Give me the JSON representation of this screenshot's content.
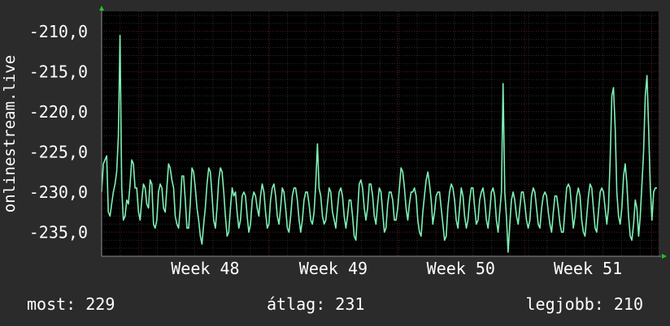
{
  "chart_data": {
    "type": "line",
    "ylabel": "onlinestream.live",
    "ylim": [
      -238.0,
      -207.5
    ],
    "yticks": [
      -235,
      -230,
      -225,
      -220,
      -215,
      -210
    ],
    "ytick_labels": [
      "-235,0",
      "-230,0",
      "-225,0",
      "-220,0",
      "-215,0",
      "-210,0"
    ],
    "xticks": [
      {
        "label": "Week 48",
        "pos": 0.186
      },
      {
        "label": "Week 49",
        "pos": 0.416
      },
      {
        "label": "Week 50",
        "pos": 0.645
      },
      {
        "label": "Week 51",
        "pos": 0.873
      }
    ],
    "grid": true,
    "colors": {
      "background": "#2b2b2b",
      "plot_bg": "#000000",
      "grid_major": "#5a1c1c",
      "grid_minor": "#2c2c2c",
      "line": "#7ef0b4",
      "axis": "#8c8c8c",
      "arrow": "#23c623"
    },
    "series": [
      {
        "values": [
          -230.0,
          -226.5,
          -226.0,
          -225.5,
          -232.5,
          -233.0,
          -231.5,
          -230.0,
          -229.0,
          -227.5,
          -223.0,
          -210.5,
          -229.5,
          -233.5,
          -233.0,
          -231.0,
          -231.5,
          -229.0,
          -226.0,
          -226.5,
          -229.5,
          -229.5,
          -232.5,
          -233.5,
          -231.0,
          -229.0,
          -229.5,
          -231.5,
          -232.0,
          -228.5,
          -229.0,
          -234.0,
          -234.5,
          -233.5,
          -230.0,
          -229.0,
          -229.5,
          -232.0,
          -232.5,
          -229.5,
          -226.5,
          -227.0,
          -228.5,
          -229.5,
          -233.0,
          -234.0,
          -234.5,
          -232.0,
          -228.0,
          -228.0,
          -231.0,
          -234.5,
          -234.5,
          -231.5,
          -227.0,
          -227.5,
          -229.5,
          -232.0,
          -233.5,
          -235.5,
          -236.5,
          -234.0,
          -232.0,
          -229.0,
          -227.0,
          -227.5,
          -230.5,
          -233.5,
          -234.5,
          -232.0,
          -228.5,
          -227.0,
          -227.5,
          -230.0,
          -233.0,
          -235.5,
          -235.0,
          -232.0,
          -229.5,
          -230.5,
          -230.0,
          -232.5,
          -234.5,
          -233.5,
          -230.5,
          -230.0,
          -230.5,
          -233.0,
          -235.0,
          -234.0,
          -231.0,
          -230.0,
          -230.5,
          -232.0,
          -233.0,
          -230.5,
          -229.0,
          -230.0,
          -232.5,
          -234.5,
          -234.0,
          -231.0,
          -229.5,
          -229.0,
          -230.5,
          -233.0,
          -234.0,
          -232.0,
          -229.5,
          -230.0,
          -232.0,
          -234.5,
          -235.0,
          -233.0,
          -230.5,
          -229.5,
          -229.5,
          -231.0,
          -233.5,
          -235.0,
          -233.5,
          -231.0,
          -230.0,
          -230.0,
          -231.5,
          -233.5,
          -234.0,
          -232.5,
          -229.0,
          -224.0,
          -229.5,
          -230.5,
          -233.0,
          -234.0,
          -233.5,
          -231.5,
          -229.5,
          -230.0,
          -232.5,
          -233.5,
          -234.5,
          -232.0,
          -230.0,
          -229.5,
          -230.5,
          -233.0,
          -234.5,
          -233.0,
          -231.0,
          -231.0,
          -233.0,
          -235.5,
          -236.0,
          -232.5,
          -229.0,
          -228.5,
          -229.5,
          -232.0,
          -233.5,
          -232.0,
          -229.0,
          -229.0,
          -230.5,
          -233.0,
          -234.0,
          -231.5,
          -229.5,
          -230.0,
          -232.5,
          -235.0,
          -234.5,
          -231.5,
          -230.0,
          -230.0,
          -231.0,
          -233.5,
          -233.5,
          -232.0,
          -229.5,
          -227.0,
          -227.5,
          -229.5,
          -232.0,
          -233.5,
          -231.5,
          -230.0,
          -230.0,
          -229.5,
          -230.5,
          -233.5,
          -235.0,
          -235.5,
          -232.5,
          -230.5,
          -228.5,
          -227.5,
          -229.0,
          -231.0,
          -234.0,
          -232.5,
          -230.5,
          -230.0,
          -230.0,
          -232.0,
          -234.0,
          -236.0,
          -235.5,
          -232.0,
          -230.0,
          -229.0,
          -229.5,
          -231.0,
          -233.5,
          -234.5,
          -232.0,
          -229.5,
          -230.5,
          -233.0,
          -234.5,
          -233.5,
          -231.0,
          -229.5,
          -229.5,
          -232.0,
          -234.0,
          -233.5,
          -231.0,
          -230.0,
          -229.5,
          -231.0,
          -233.5,
          -234.5,
          -232.5,
          -230.0,
          -229.5,
          -230.5,
          -233.5,
          -235.0,
          -232.5,
          -230.0,
          -216.5,
          -230.0,
          -233.0,
          -237.5,
          -234.0,
          -231.0,
          -230.0,
          -231.0,
          -233.0,
          -234.0,
          -232.0,
          -230.0,
          -230.0,
          -231.5,
          -233.5,
          -234.5,
          -233.5,
          -230.5,
          -229.5,
          -230.0,
          -232.0,
          -234.0,
          -234.5,
          -232.0,
          -230.5,
          -230.0,
          -230.5,
          -232.5,
          -234.0,
          -235.0,
          -232.5,
          -230.5,
          -230.5,
          -232.0,
          -234.0,
          -235.0,
          -235.0,
          -232.0,
          -229.5,
          -229.0,
          -229.5,
          -232.0,
          -234.5,
          -233.0,
          -230.5,
          -229.5,
          -230.5,
          -233.5,
          -235.0,
          -235.5,
          -233.0,
          -230.5,
          -229.0,
          -229.5,
          -232.0,
          -234.5,
          -235.0,
          -232.5,
          -230.0,
          -229.5,
          -230.0,
          -232.0,
          -234.0,
          -232.0,
          -226.0,
          -218.0,
          -217.0,
          -222.0,
          -230.0,
          -233.0,
          -234.0,
          -232.0,
          -228.0,
          -226.5,
          -229.0,
          -233.0,
          -235.5,
          -236.0,
          -234.0,
          -231.0,
          -232.0,
          -235.5,
          -233.0,
          -229.0,
          -225.0,
          -218.0,
          -215.5,
          -222.0,
          -229.5,
          -233.5,
          -230.0,
          -229.5,
          -229.5
        ]
      }
    ]
  },
  "stats": {
    "now": "most: 229",
    "avg": "átlag: 231",
    "best": "legjobb: 210"
  }
}
